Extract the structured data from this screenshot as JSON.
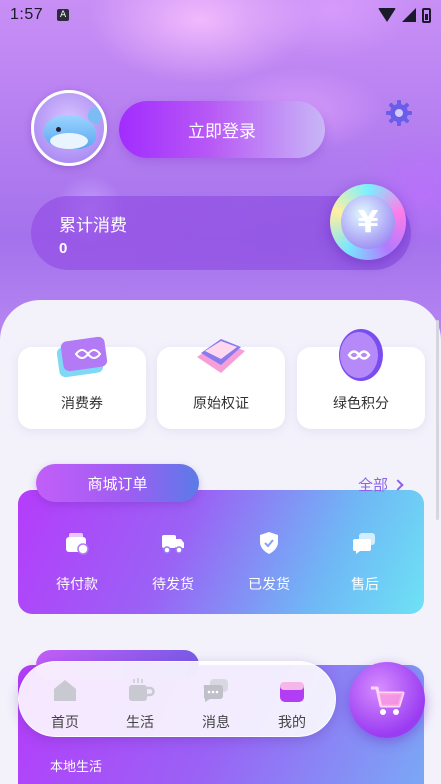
{
  "status_bar": {
    "time": "1:57",
    "notification": "A"
  },
  "profile": {
    "login_label": "立即登录"
  },
  "spend": {
    "label": "累计消费",
    "value": "0",
    "coin_symbol": "¥"
  },
  "quick_actions": [
    {
      "label": "消费券",
      "icon": "voucher-cards-icon"
    },
    {
      "label": "原始权证",
      "icon": "book-icon"
    },
    {
      "label": "绿色积分",
      "icon": "infinity-coin-icon"
    }
  ],
  "orders": {
    "title": "商城订单",
    "all_label": "全部",
    "items": [
      {
        "label": "待付款",
        "icon": "wallet-icon"
      },
      {
        "label": "待发货",
        "icon": "truck-icon"
      },
      {
        "label": "已发货",
        "icon": "shield-check-icon"
      },
      {
        "label": "售后",
        "icon": "chat-icon"
      }
    ]
  },
  "local": {
    "label": "本地生活"
  },
  "bottom_nav": [
    {
      "label": "首页",
      "icon": "home-icon"
    },
    {
      "label": "生活",
      "icon": "coffee-cup-icon"
    },
    {
      "label": "消息",
      "icon": "message-icon"
    },
    {
      "label": "我的",
      "icon": "profile-bag-icon"
    }
  ],
  "colors": {
    "accent": "#a22cff",
    "link": "#8a63e8",
    "order_gradient_end": "#6ee2f5"
  }
}
